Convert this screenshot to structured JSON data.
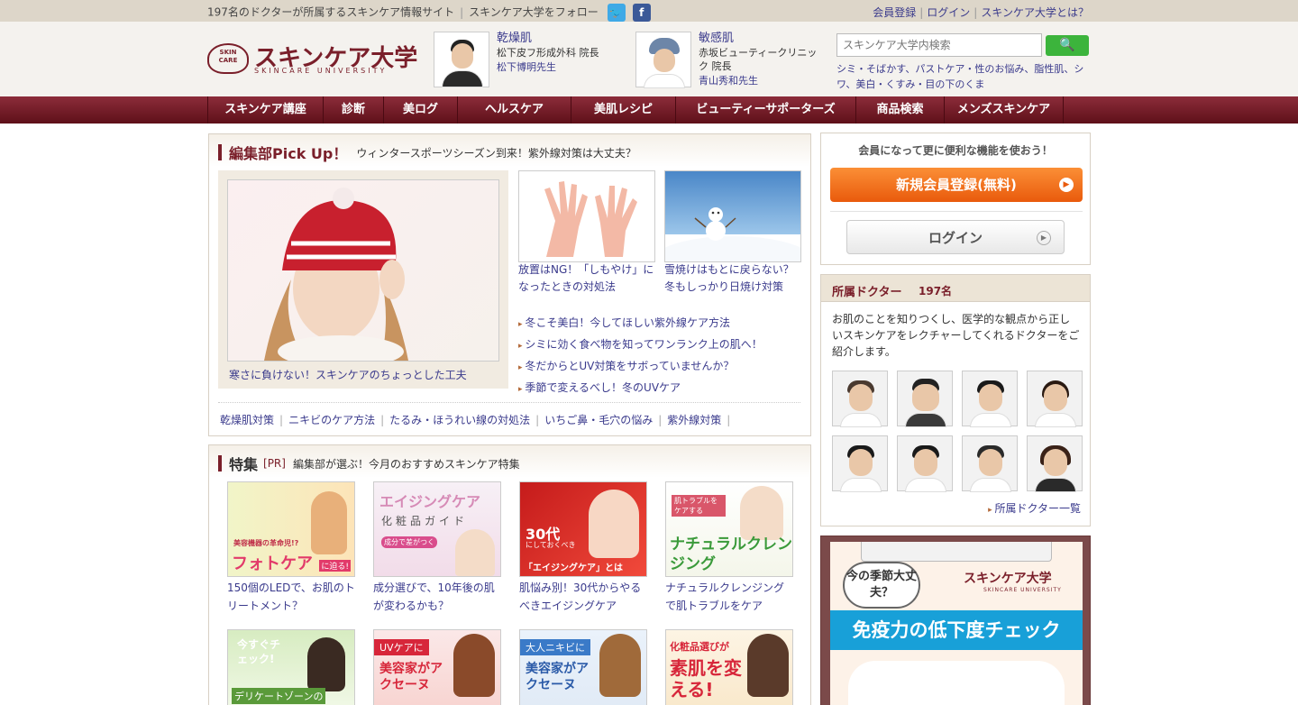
{
  "topbar": {
    "tagline": "197名のドクターが所属するスキンケア情報サイト",
    "follow": "スキンケア大学をフォロー",
    "links": [
      "会員登録",
      "ログイン",
      "スキンケア大学とは？"
    ]
  },
  "logo": {
    "mark": "SKIN CARE",
    "jp": "スキンケア大学",
    "en": "SKINCARE UNIVERSITY"
  },
  "doctors_header": [
    {
      "category": "乾燥肌",
      "clinic": "松下皮フ形成外科 院長",
      "name": "松下博明先生"
    },
    {
      "category": "敏感肌",
      "clinic": "赤坂ビューティークリニック 院長",
      "name": "青山秀和先生"
    }
  ],
  "search": {
    "placeholder": "スキンケア大学内検索",
    "keywords": "シミ・そばかす、パストケア・性のお悩み、脂性肌、シワ、美白・くすみ・目の下のくま"
  },
  "nav": [
    "スキンケア講座",
    "診断",
    "美ログ",
    "ヘルスケア",
    "美肌レシピ",
    "ビューティーサポーターズ",
    "商品検索",
    "メンズスキンケア"
  ],
  "pickup": {
    "title": "編集部Pick Up！",
    "subtitle": "ウィンタースポーツシーズン到来！紫外線対策は大丈夫？",
    "main_caption": "寒さに負けない！スキンケアのちょっとした工夫",
    "thumb1_caption": "放置はNG！「しもやけ」になったときの対処法",
    "thumb2_caption": "雪焼けはもとに戻らない？冬もしっかり日焼け対策",
    "list": [
      "冬こそ美白！今してほしい紫外線ケア方法",
      "シミに効く食べ物を知ってワンランク上の肌へ！",
      "冬だからとUV対策をサボっていませんか？",
      "季節で変えるべし！冬のUVケア"
    ],
    "tags": [
      "乾燥肌対策",
      "ニキビのケア方法",
      "たるみ・ほうれい線の対処法",
      "いちご鼻・毛穴の悩み",
      "紫外線対策"
    ]
  },
  "feature": {
    "title": "特集",
    "pr": "[PR]",
    "subtitle": "編集部が選ぶ！今月のおすすめスキンケア特集",
    "items": [
      {
        "caption": "150個のLEDで、お肌のトリートメント？",
        "banner_top": "美容機器の革命児!?",
        "banner_main": "フォトケア",
        "banner_sub": "に迫る!"
      },
      {
        "caption": "成分選びで、10年後の肌が変わるかも？",
        "banner_top": "エイジングケア",
        "banner_main": "化粧品ガイド",
        "banner_sub": "成分で差がつく"
      },
      {
        "caption": "肌悩み別！30代からやるべきエイジングケア",
        "banner_top": "30代",
        "banner_main": "「エイジングケア」とは",
        "banner_sub": "にしておくべき"
      },
      {
        "caption": "ナチュラルクレンジングで肌トラブルをケア",
        "banner_top": "肌トラブルをケアする",
        "banner_main": "ナチュラルクレンジング",
        "banner_sub": ""
      }
    ],
    "row2": [
      {
        "top": "今すぐチェック!",
        "main": "デリケートゾーンの"
      },
      {
        "top": "UVケアに",
        "main": "美容家がアクセーヌ"
      },
      {
        "top": "大人ニキビに",
        "main": "美容家がアクセーヌ"
      },
      {
        "top": "化粧品選びが",
        "main": "素肌を変える!"
      }
    ]
  },
  "member": {
    "heading": "会員になって更に便利な機能を使おう！",
    "register": "新規会員登録(無料)",
    "login": "ログイン"
  },
  "doctors_panel": {
    "title": "所属ドクター",
    "count": "197名",
    "desc": "お肌のことを知りつくし、医学的な観点から正しいスキンケアをレクチャーしてくれるドクターをご紹介します。",
    "more": "所属ドクター一覧"
  },
  "ad": {
    "bubble": "今の季節大丈夫？",
    "logo": "スキンケア大学",
    "logo_en": "SKINCARE UNIVERSITY",
    "headline": "免疫力の低下度チェック"
  },
  "colors": {
    "brand": "#7a1f2a",
    "link": "#3a3a8c",
    "accent": "#e95a0c",
    "search": "#3cb43c"
  }
}
